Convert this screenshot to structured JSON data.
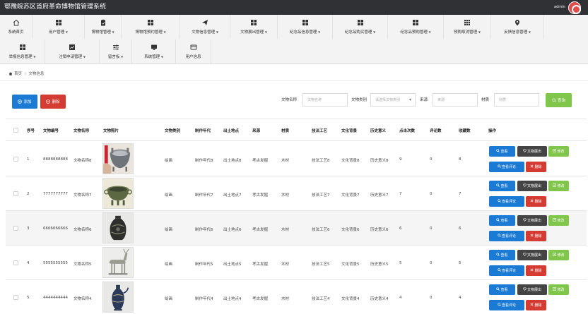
{
  "header": {
    "title": "鄂豫皖苏区首府革命博物馆管理系统",
    "user": "admin"
  },
  "nav": {
    "row1": [
      {
        "label": "系统首页",
        "icon": "home-icon"
      },
      {
        "label": "用户管理",
        "icon": "grid-icon"
      },
      {
        "label": "博物馆管理",
        "icon": "clipboard-icon"
      },
      {
        "label": "博物馆预约管理",
        "icon": "grid-icon"
      },
      {
        "label": "文物信息管理",
        "icon": "send-icon"
      },
      {
        "label": "文物展出管理",
        "icon": "grid-icon"
      },
      {
        "label": "纪念品信息管理",
        "icon": "grid-icon"
      },
      {
        "label": "纪念品购买管理",
        "icon": "grid-icon"
      },
      {
        "label": "纪念品预购管理",
        "icon": "grid-icon"
      },
      {
        "label": "预购取消管理",
        "icon": "apps-icon"
      },
      {
        "label": "反馈信息管理",
        "icon": "pin-icon"
      }
    ],
    "row2": [
      {
        "label": "举报信息管理",
        "icon": "grid-icon"
      },
      {
        "label": "注销申请管理",
        "icon": "chart-icon"
      },
      {
        "label": "留言板",
        "icon": "sliders-icon"
      },
      {
        "label": "系统管理",
        "icon": "monitor-icon"
      },
      {
        "label": "用户信息",
        "icon": "card-icon"
      }
    ]
  },
  "breadcrumb": {
    "home": "首页",
    "sep": "/",
    "current": "文物信息"
  },
  "toolbar": {
    "add": "添加",
    "delete": "删除",
    "query": "查询"
  },
  "filters": {
    "name_label": "文物名称",
    "name_placeholder": "文物名称",
    "category_label": "文物类别",
    "category_placeholder": "请选择文物类别",
    "source_label": "来源",
    "source_placeholder": "来源",
    "material_label": "材质",
    "material_placeholder": "材质"
  },
  "table": {
    "headers": [
      "序号",
      "文物编号",
      "文物名称",
      "文物照片",
      "文物类别",
      "制作年代",
      "出土地点",
      "来源",
      "材质",
      "技法工艺",
      "文化背景",
      "历史意义",
      "点击次数",
      "评论数",
      "收藏数",
      "操作"
    ],
    "actions": {
      "view": "查看",
      "exhibit": "文物展出",
      "edit": "修改",
      "comments": "查看评论",
      "delete": "删除"
    },
    "rows": [
      {
        "idx": "1",
        "code": "8888888888",
        "name": "文物名称8",
        "category": "绘画",
        "era": "制作年代8",
        "site": "出土地点8",
        "source": "考古发掘",
        "material": "木材",
        "craft": "技法工艺8",
        "culture": "文化背景8",
        "history": "历史意义8",
        "clicks": "9",
        "comments": "0",
        "favs": "8",
        "photo": "cauldron"
      },
      {
        "idx": "2",
        "code": "7777777777",
        "name": "文物名称7",
        "category": "绘画",
        "era": "制作年代7",
        "site": "出土地点7",
        "source": "考古发掘",
        "material": "木材",
        "craft": "技法工艺7",
        "culture": "文化背景7",
        "history": "历史意义7",
        "clicks": "7",
        "comments": "0",
        "favs": "7",
        "photo": "bronze-bowl"
      },
      {
        "idx": "3",
        "code": "6666666666",
        "name": "文物名称6",
        "category": "绘画",
        "era": "制作年代6",
        "site": "出土地点6",
        "source": "考古发掘",
        "material": "木材",
        "craft": "技法工艺6",
        "culture": "文化背景6",
        "history": "历史意义6",
        "clicks": "6",
        "comments": "0",
        "favs": "6",
        "photo": "vase"
      },
      {
        "idx": "4",
        "code": "5555555555",
        "name": "文物名称5",
        "category": "绘画",
        "era": "制作年代5",
        "site": "出土地点5",
        "source": "考古发掘",
        "material": "木材",
        "craft": "技法工艺5",
        "culture": "文化背景5",
        "history": "历史意义5",
        "clicks": "5",
        "comments": "0",
        "favs": "5",
        "photo": "deer"
      },
      {
        "idx": "5",
        "code": "4444444444",
        "name": "文物名称4",
        "category": "绘画",
        "era": "制作年代4",
        "site": "出土地点4",
        "source": "考古发掘",
        "material": "木材",
        "craft": "技法工艺4",
        "culture": "文化背景4",
        "history": "历史意义4",
        "clicks": "4",
        "comments": "0",
        "favs": "4",
        "photo": "ewer"
      }
    ]
  }
}
